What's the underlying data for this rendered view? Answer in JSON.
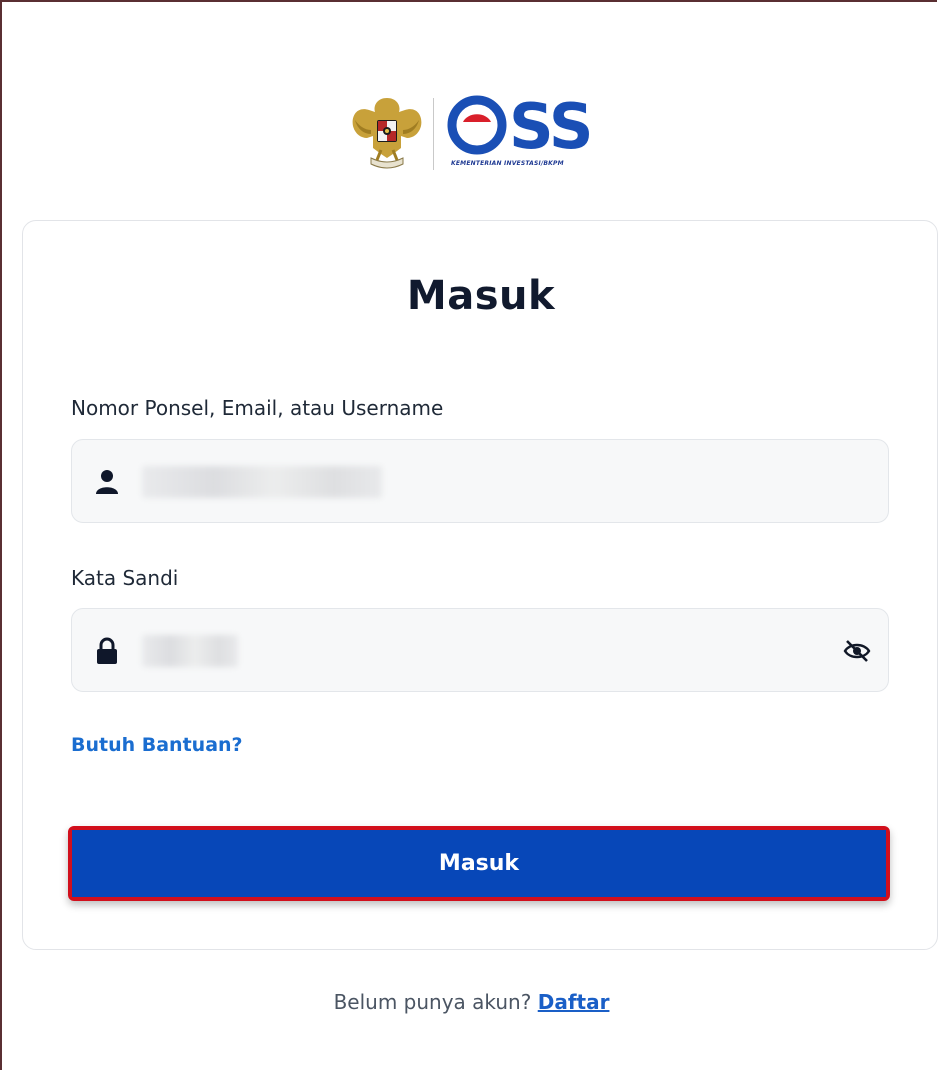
{
  "logo": {
    "emblem": "garuda-emblem",
    "brand": "OSS",
    "subtitle": "KEMENTERIAN INVESTASI/BKPM",
    "brand_color": "#1a4fb5",
    "accent_color": "#d91f2a"
  },
  "form": {
    "title": "Masuk",
    "username": {
      "label": "Nomor Ponsel, Email, atau Username",
      "icon": "user-icon",
      "value": "••••••••••••••"
    },
    "password": {
      "label": "Kata Sandi",
      "icon": "lock-icon",
      "toggle_icon": "eye-off-icon",
      "value": "•••••"
    },
    "help_link": "Butuh Bantuan?",
    "submit_label": "Masuk",
    "submit_color": "#0747b8",
    "highlight_color": "#d10f1c"
  },
  "footer": {
    "prompt": "Belum punya akun?",
    "register_link": "Daftar"
  }
}
